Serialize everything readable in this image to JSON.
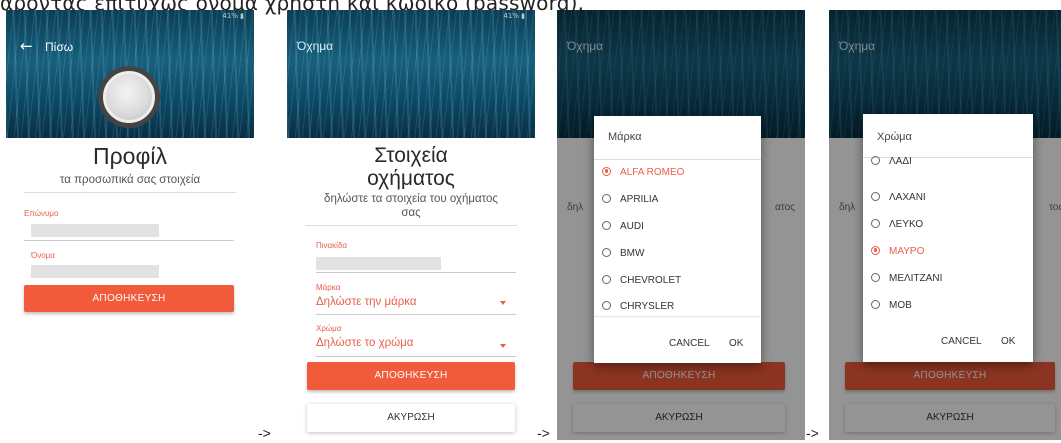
{
  "caption": "αρόντας επιτυχώς όνομα χρήστη και κωδικό (password).",
  "status_text": "41% ▮",
  "arrow": "->",
  "screen1": {
    "back_label": "Πίσω",
    "title": "Προφίλ",
    "subtitle": "τα προσωπικά σας στοιχεία",
    "surname_label": "Επώνυμο",
    "name_label": "Όνομα",
    "save_button": "ΑΠΟΘΗΚΕΥΣΗ"
  },
  "screen2": {
    "header_title": "Όχημα",
    "title_line1": "Στοιχεία",
    "title_line2": "οχήματος",
    "subtitle_line1": "δηλώστε τα στοιχεία του οχήματος",
    "subtitle_line2": "σας",
    "plate_label": "Πινακίδα",
    "brand_label": "Μάρκα",
    "brand_value": "Δηλώστε την μάρκα",
    "color_label": "Χρώμα",
    "color_value": "Δηλώστε το χρώμα",
    "save_button": "ΑΠΟΘΗΚΕΥΣΗ",
    "cancel_button": "ΑΚΥΡΩΣΗ"
  },
  "screen3": {
    "header_title": "Όχημα",
    "bg_left": "δηλ",
    "bg_right": "ατος",
    "dialog_title": "Μάρκα",
    "options": [
      "ALFA ROMEO",
      "APRILIA",
      "AUDI",
      "BMW",
      "CHEVROLET",
      "CHRYSLER"
    ],
    "selected": "ALFA ROMEO",
    "cancel": "CANCEL",
    "ok": "OK",
    "save_button": "ΑΠΟΘΗΚΕΥΣΗ",
    "cancel_button": "ΑΚΥΡΩΣΗ"
  },
  "screen4": {
    "header_title": "Όχημα",
    "bg_left": "δηλ",
    "bg_right": "τος",
    "dialog_title": "Χρώμα",
    "options": [
      "ΛΑΔΙ",
      "ΛΑΧΑΝΙ",
      "ΛΕΥΚΟ",
      "ΜΑΥΡΟ",
      "ΜΕΛΙΤΖΑΝΙ",
      "ΜΟΒ"
    ],
    "selected": "ΜΑΥΡΟ",
    "cancel": "CANCEL",
    "ok": "OK",
    "save_button": "ΑΠΟΘΗΚΕΥΣΗ",
    "cancel_button": "ΑΚΥΡΩΣΗ"
  },
  "colors": {
    "accent": "#f25a3c",
    "label": "#e8604a"
  }
}
